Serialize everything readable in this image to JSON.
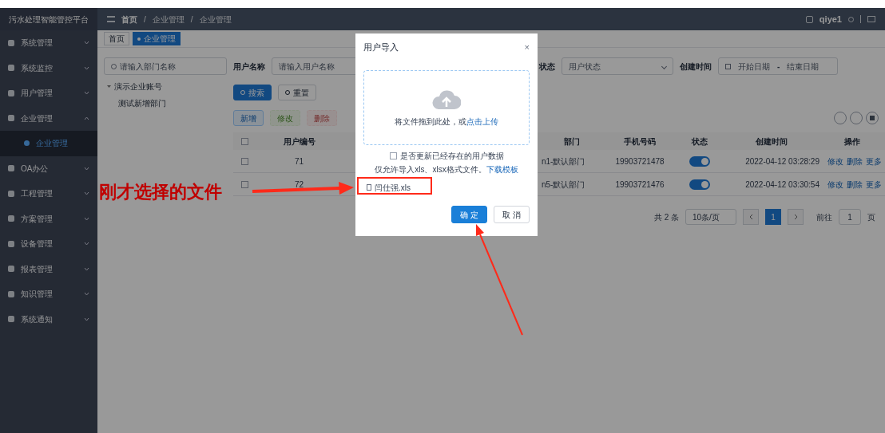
{
  "app": {
    "title": "污水处理智能管控平台"
  },
  "sidebar": {
    "items": [
      {
        "label": "系统管理",
        "expanded": false
      },
      {
        "label": "系统监控",
        "expanded": false
      },
      {
        "label": "用户管理",
        "expanded": false
      },
      {
        "label": "企业管理",
        "expanded": true,
        "children": [
          {
            "label": "企业管理",
            "selected": true
          }
        ]
      },
      {
        "label": "OA办公",
        "expanded": false
      },
      {
        "label": "工程管理",
        "expanded": false
      },
      {
        "label": "方案管理",
        "expanded": false
      },
      {
        "label": "设备管理",
        "expanded": false
      },
      {
        "label": "报表管理",
        "expanded": false
      },
      {
        "label": "知识管理",
        "expanded": false
      },
      {
        "label": "系统通知",
        "expanded": false
      }
    ]
  },
  "header": {
    "breadcrumb": [
      "首页",
      "企业管理",
      "企业管理"
    ],
    "breadcrumb_separator": "/",
    "user": "qiye1"
  },
  "tabs": [
    {
      "label": "首页",
      "selected": false
    },
    {
      "label": "企业管理",
      "selected": true
    }
  ],
  "dept_panel": {
    "search_placeholder": "请输入部门名称",
    "tree": [
      {
        "label": "演示企业账号",
        "expanded": true,
        "children": [
          {
            "label": "测试新增部门"
          }
        ]
      }
    ]
  },
  "filters": [
    {
      "kind": "input",
      "label": "用户名称",
      "placeholder": "请输入用户名称"
    },
    {
      "kind": "select",
      "label": "状态",
      "placeholder": "用户状态"
    },
    {
      "kind": "daterange",
      "label": "创建时间",
      "start_placeholder": "开始日期",
      "separator": "-",
      "end_placeholder": "结束日期"
    }
  ],
  "search_buttons": [
    {
      "kind": "primary",
      "label": "搜索"
    },
    {
      "kind": "plain",
      "label": "重置"
    }
  ],
  "action_buttons": [
    {
      "kind": "add",
      "label": "新增",
      "disabled": false
    },
    {
      "kind": "edit",
      "label": "修改",
      "disabled": true
    },
    {
      "kind": "delete",
      "label": "删除",
      "disabled": true
    }
  ],
  "table": {
    "all_checked": false,
    "columns": [
      "用户编号",
      "部门",
      "手机号码",
      "状态",
      "创建时间",
      "操作"
    ],
    "rows": [
      {
        "checked": false,
        "id": "71",
        "dept": "n1-默认部门",
        "phone": "19903721478",
        "enabled": true,
        "created": "2022-04-12 03:28:29",
        "actions": [
          "修改",
          "删除",
          "更多"
        ]
      },
      {
        "checked": false,
        "id": "72",
        "dept": "n5-默认部门",
        "phone": "19903721476",
        "enabled": true,
        "created": "2022-04-12 03:30:54",
        "actions": [
          "修改",
          "删除",
          "更多"
        ]
      }
    ]
  },
  "pagination": {
    "total": "共 2 条",
    "page_size": "10条/页",
    "pages": [
      {
        "label": "1",
        "selected": true
      }
    ],
    "goto_label": "前往",
    "goto_value": "1",
    "goto_suffix": "页"
  },
  "modal": {
    "title": "用户导入",
    "close": "×",
    "drop_text": "将文件拖到此处，或",
    "upload_link": "点击上传",
    "update_existing": {
      "label": "是否更新已经存在的用户数据",
      "checked": false
    },
    "hint": "仅允许导入xls、xlsx格式文件。",
    "template_link": "下载模板",
    "file": "闫仕强.xls",
    "buttons": [
      {
        "kind": "primary",
        "label": "确 定"
      },
      {
        "kind": "plain",
        "label": "取 消"
      }
    ]
  },
  "annotation": {
    "text": "刚才选择的文件"
  }
}
